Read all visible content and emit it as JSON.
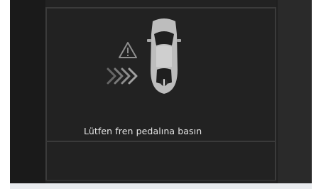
{
  "screen": {
    "message": "Lütfen fren pedalına basın"
  },
  "icons": {
    "warning": "warning-triangle-icon",
    "arrows": "approach-arrows-icon",
    "car": "car-topview-icon",
    "driver": "driver-seat-icon"
  },
  "colors": {
    "background": "#222222",
    "text": "#e6e6e6",
    "icon": "#bdbdbd"
  }
}
